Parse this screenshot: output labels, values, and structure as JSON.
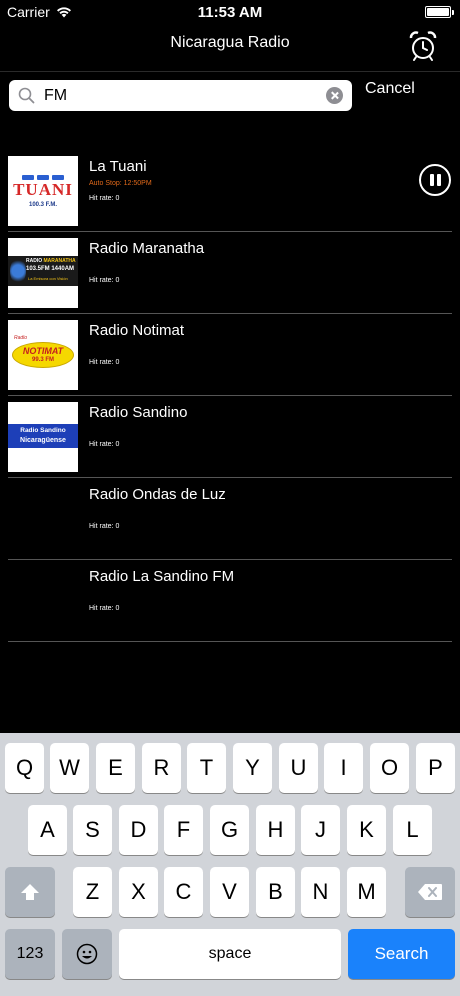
{
  "status_bar": {
    "carrier": "Carrier",
    "time": "11:53 AM"
  },
  "nav": {
    "title": "Nicaragua Radio",
    "alarm_icon": "alarm-clock-icon"
  },
  "search": {
    "value": "FM",
    "placeholder": "",
    "cancel_label": "Cancel"
  },
  "stations": [
    {
      "name": "La Tuani",
      "auto_stop": "Auto Stop: 12:50PM",
      "hit_rate": "Hit rate: 0",
      "playing": true,
      "logo": {
        "l1": "TUANI",
        "l2": "100.3 F.M."
      }
    },
    {
      "name": "Radio Maranatha",
      "auto_stop": "",
      "hit_rate": "Hit rate: 0",
      "logo": {
        "l1a": "RADIO ",
        "l1b": "MARANATHA",
        "l2": "103.5FM 1440AM",
        "l3": "La Emisora con Visión"
      }
    },
    {
      "name": "Radio Notimat",
      "auto_stop": "",
      "hit_rate": "Hit rate: 0",
      "logo": {
        "l0": "Radio",
        "l1": "NOTIMAT",
        "l2": "99.3 FM"
      }
    },
    {
      "name": "Radio Sandino",
      "auto_stop": "",
      "hit_rate": "Hit rate: 0",
      "logo": {
        "l1": "Radio Sandino",
        "l2": "Nicaragüense"
      }
    },
    {
      "name": "Radio Ondas de Luz",
      "auto_stop": "",
      "hit_rate": "Hit rate: 0"
    },
    {
      "name": "Radio La Sandino FM",
      "auto_stop": "",
      "hit_rate": "Hit rate: 0"
    }
  ],
  "keyboard": {
    "row1": [
      "Q",
      "W",
      "E",
      "R",
      "T",
      "Y",
      "U",
      "I",
      "O",
      "P"
    ],
    "row2": [
      "A",
      "S",
      "D",
      "F",
      "G",
      "H",
      "J",
      "K",
      "L"
    ],
    "row3": [
      "Z",
      "X",
      "C",
      "V",
      "B",
      "N",
      "M"
    ],
    "numbers_label": "123",
    "space_label": "space",
    "search_label": "Search"
  },
  "colors": {
    "accent_blue": "#1a82fb",
    "auto_stop_orange": "#e0691a",
    "background": "#000000",
    "keyboard_bg": "#d1d4d9"
  }
}
